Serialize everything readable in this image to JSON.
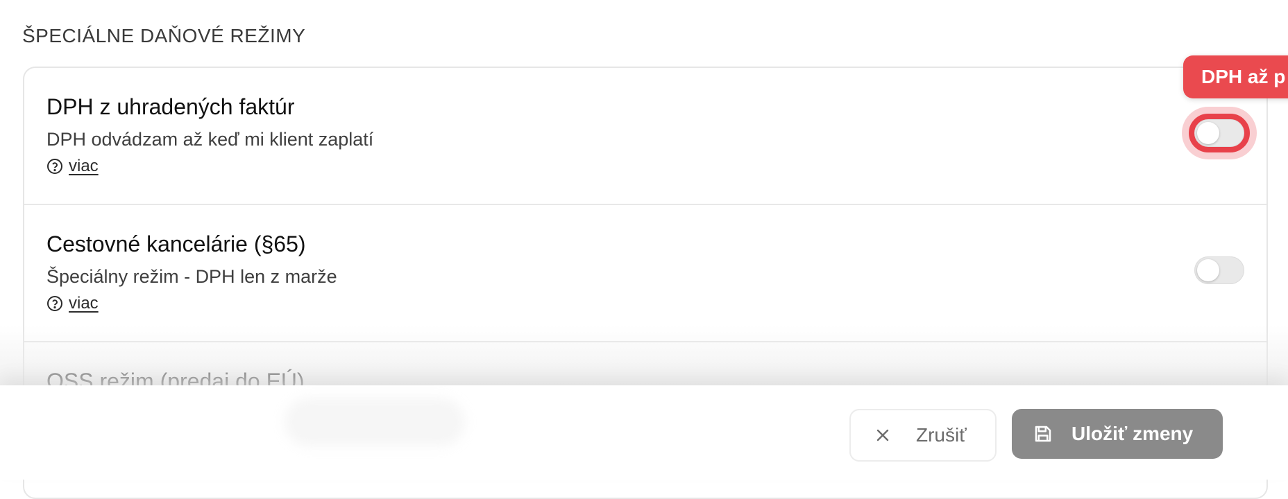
{
  "section": {
    "title": "ŠPECIÁLNE DAŇOVÉ REŽIMY"
  },
  "settings": [
    {
      "title": "DPH z uhradených faktúr",
      "description": "DPH odvádzam až keď mi klient zaplatí",
      "more": "viac",
      "enabled": false
    },
    {
      "title": "Cestovné kancelárie (§65)",
      "description": "Špeciálny režim - DPH len z marže",
      "more": "viac",
      "enabled": false
    },
    {
      "title": "OSS režim (predaj do EÚ)",
      "description": "",
      "more": "",
      "enabled": false
    }
  ],
  "tooltip": {
    "text": "DPH až p"
  },
  "footer": {
    "cancel_label": "Zrušiť",
    "save_label": "Uložiť zmeny"
  },
  "colors": {
    "highlight": "#e8414a",
    "save_button": "#8a8a8a"
  }
}
